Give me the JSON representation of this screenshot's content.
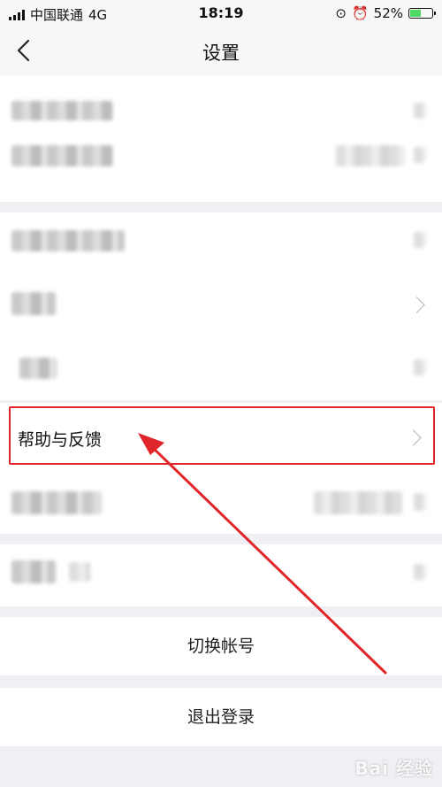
{
  "status_bar": {
    "carrier": "中国联通",
    "network": "4G",
    "time": "18:19",
    "battery_percent": "52%",
    "battery_level": 0.52,
    "battery_color": "#4cd964"
  },
  "nav": {
    "title": "设置",
    "back_icon": "chevron-left-icon"
  },
  "settings": {
    "help_feedback_label": "帮助与反馈"
  },
  "actions": {
    "switch_account": "切换帐号",
    "logout": "退出登录"
  },
  "watermark": {
    "text": "Bai 经验"
  },
  "colors": {
    "highlight": "#e0262b",
    "page_bg": "#efeff4"
  }
}
